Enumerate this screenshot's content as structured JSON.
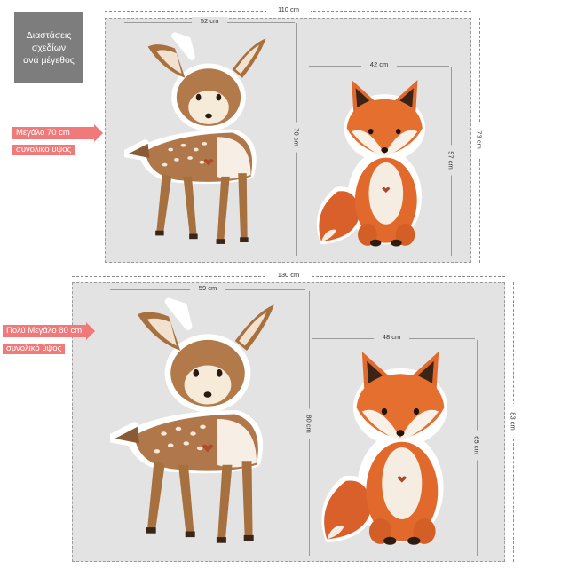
{
  "info_box": {
    "line1": "Διαστάσεις",
    "line2": "σχεδίων",
    "line3": "ανά μέγεθος"
  },
  "sizes": [
    {
      "label": "Μεγάλο  70 cm",
      "sublabel": "συνολικό  ύψος",
      "total_width": "110 cm",
      "total_height": "73 cm",
      "deer_width": "52 cm",
      "deer_height": "70 cm",
      "fox_width": "42 cm",
      "fox_height": "57 cm"
    },
    {
      "label": "Πολύ Μεγάλο  80 cm",
      "sublabel": "συνολικό  ύψος",
      "total_width": "130 cm",
      "total_height": "83 cm",
      "deer_width": "59 cm",
      "deer_height": "80 cm",
      "fox_width": "48 cm",
      "fox_height": "65 cm"
    }
  ],
  "colors": {
    "arrow": "#f07a7a",
    "panel": "#e3e3e4",
    "deer": "#b07a4a",
    "fox": "#e0692b"
  }
}
